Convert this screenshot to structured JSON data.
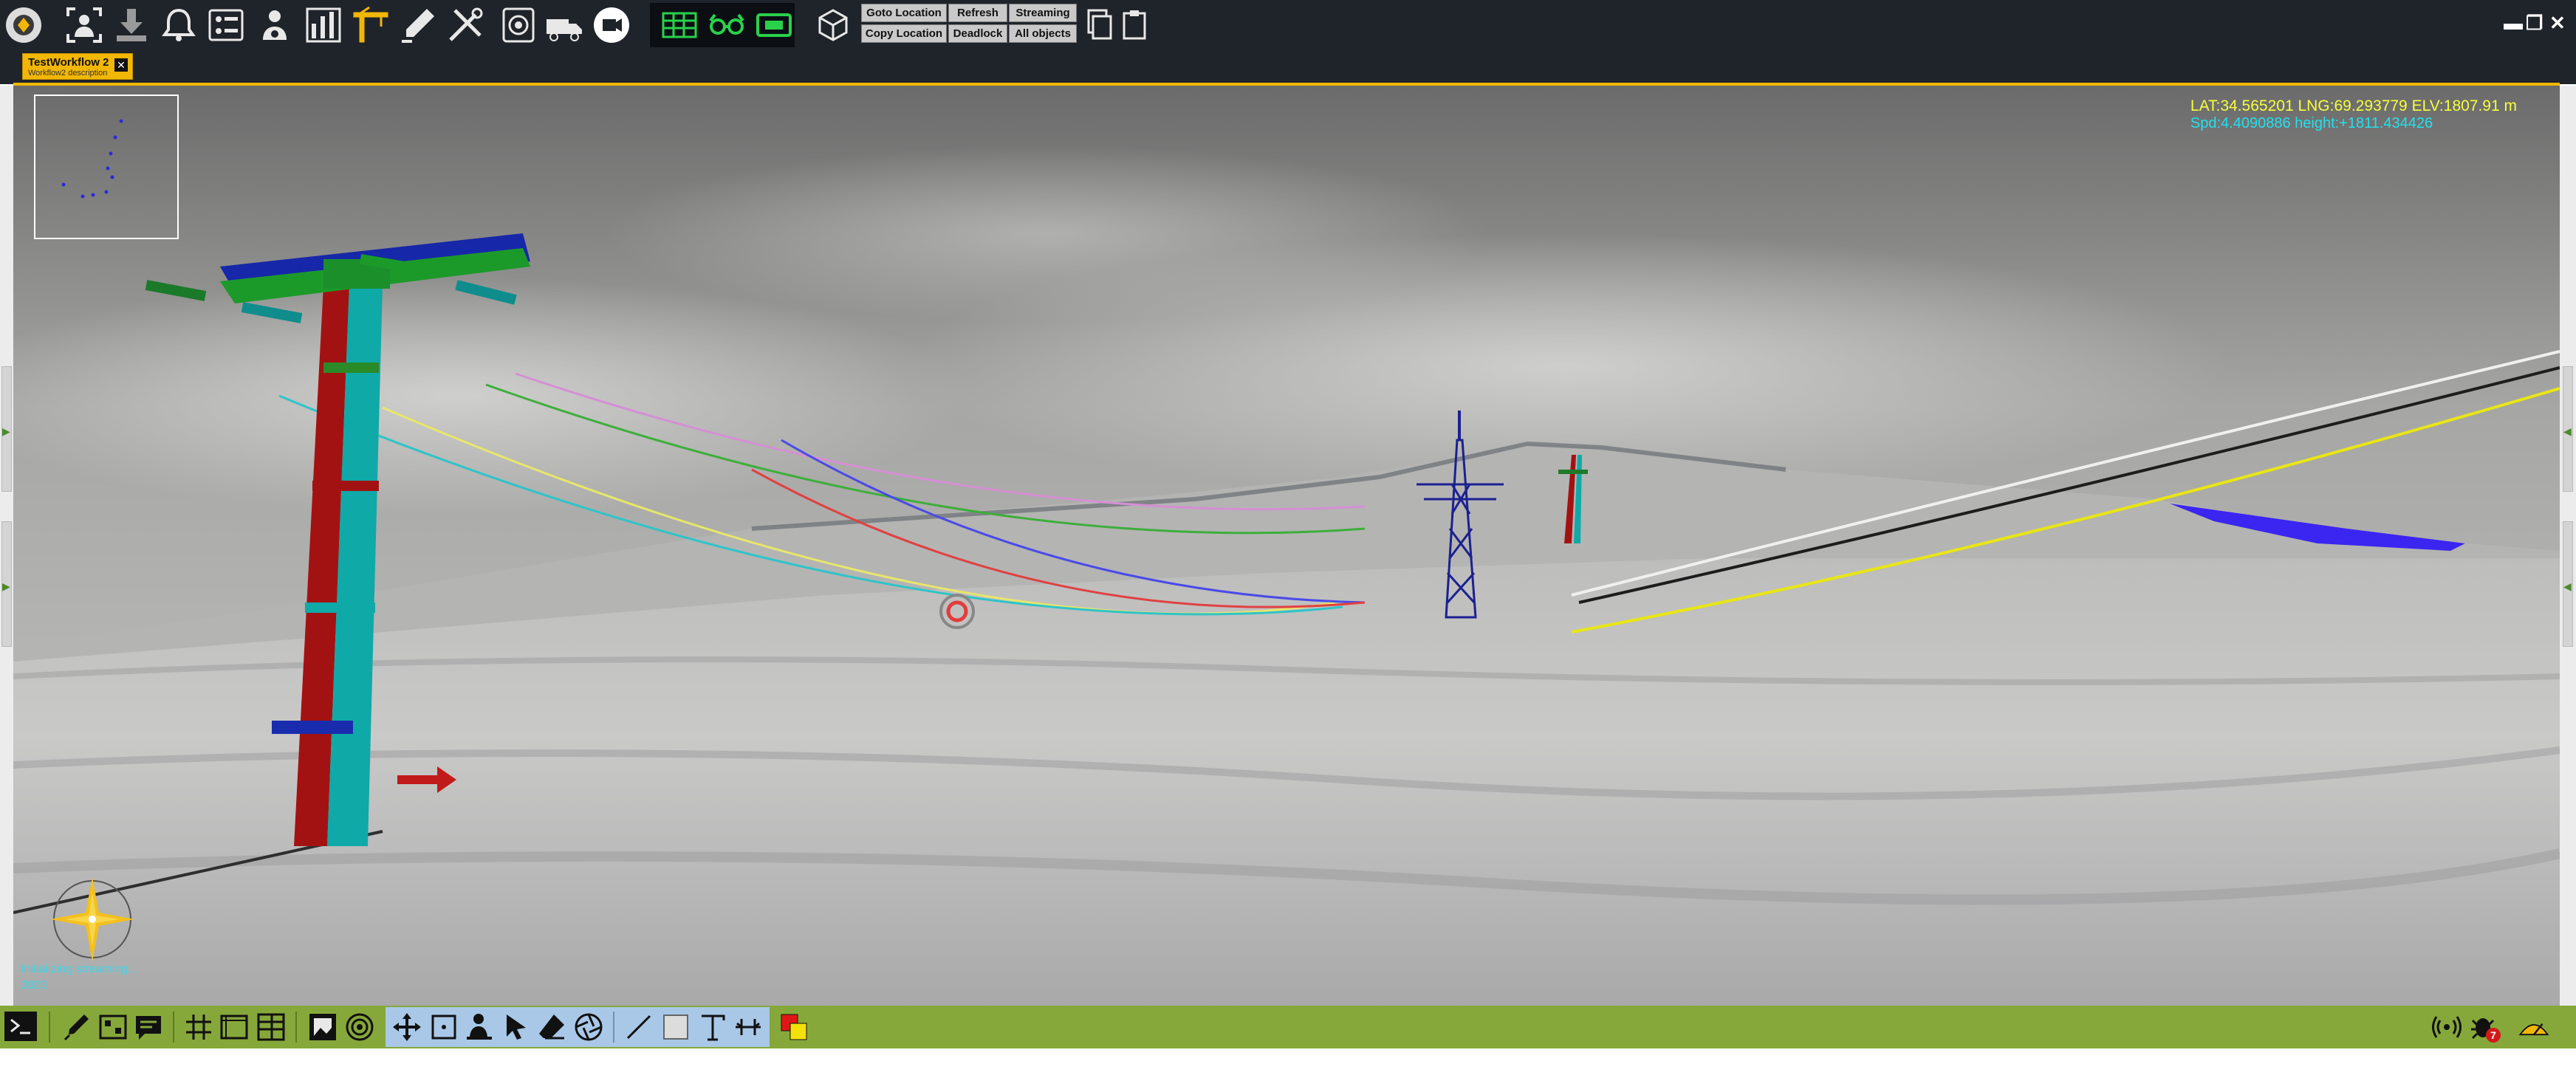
{
  "toolbar": {
    "goto_location": "Goto Location",
    "refresh": "Refresh",
    "streaming": "Streaming",
    "copy_location": "Copy Location",
    "deadlock": "Deadlock",
    "all_objects": "All objects",
    "icons": [
      "app-logo-icon",
      "download-icon",
      "bell-icon",
      "dashboard-icon",
      "user-gear-icon",
      "grid-chart-icon",
      "crane-icon",
      "pen-icon",
      "tools-icon",
      "target-icon",
      "truck-icon",
      "camera-icon",
      "table-green-icon",
      "glasses-green-icon",
      "film-green-icon",
      "cube-icon",
      "copy-icon",
      "clipboard-icon"
    ]
  },
  "tab": {
    "title": "TestWorkflow 2",
    "description": "Workflow2 description"
  },
  "hud": {
    "coords_line1": "LAT:34.565201 LNG:69.293779 ELV:1807.91 m",
    "coords_line2": "Spd:4.4090886 height:+1811.434426"
  },
  "watermark": {
    "line1": "Initializing streaming...",
    "line2": "2023"
  },
  "colors": {
    "accent": "#f2b705",
    "toolbar_bg": "#1f232a",
    "bottom_bar": "#86a83a",
    "coords_yellow": "#f6ff3b",
    "coords_cyan": "#23e0ee"
  },
  "status": {
    "notifications_count": "7"
  },
  "window": {
    "minimize": "▬",
    "restore": "❐",
    "close": "✕"
  }
}
